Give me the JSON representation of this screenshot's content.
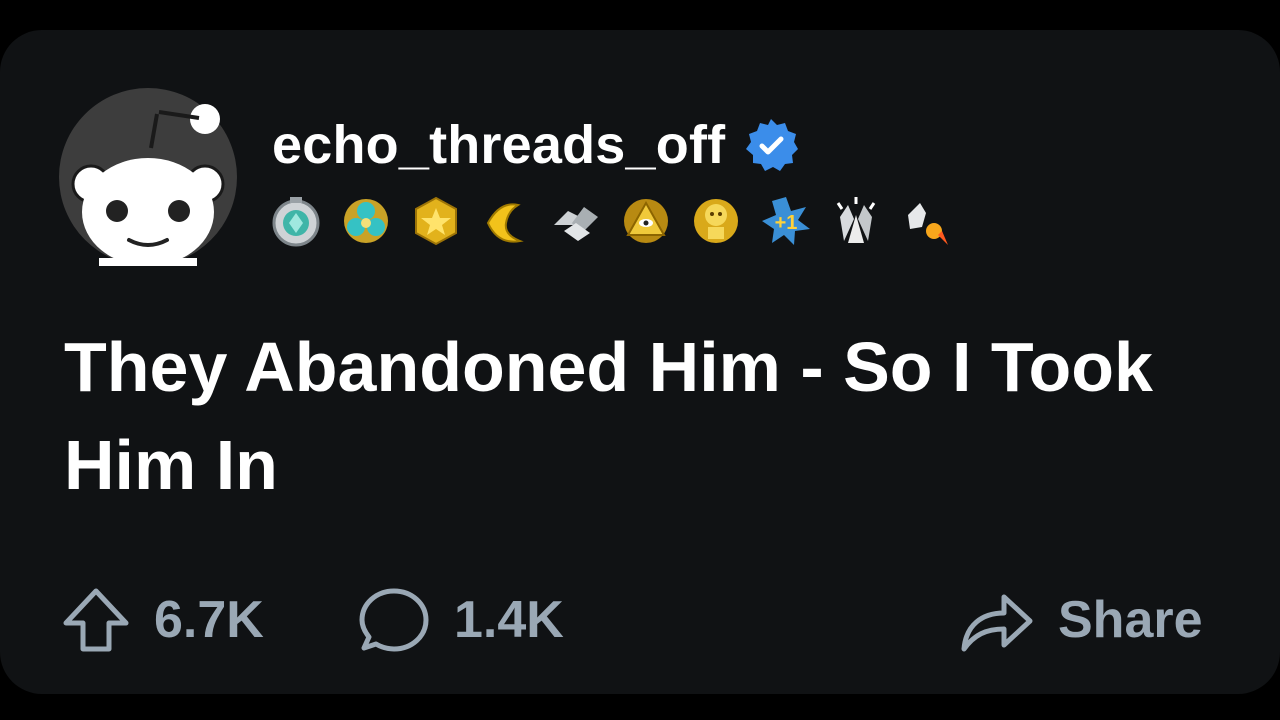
{
  "post": {
    "username": "echo_threads_off",
    "verified": true,
    "awards": [
      "silver-medal-award-icon",
      "gem-cluster-award-icon",
      "gold-star-award-icon",
      "banana-award-icon",
      "handshake-award-icon",
      "all-seeing-pyramid-award-icon",
      "snoo-robot-award-icon",
      "plus-one-award-icon",
      "clapping-hands-award-icon",
      "rocket-thumbs-up-award-icon"
    ],
    "title": "They Abandoned Him - So I Took Him In",
    "upvotes": "6.7K",
    "comments": "1.4K",
    "share_label": "Share"
  },
  "colors": {
    "background": "#000000",
    "card": "#101214",
    "text": "#ffffff",
    "action_text": "#9aa8b5",
    "verified": "#3b8dea",
    "avatar_bg": "#3d3d3d"
  }
}
